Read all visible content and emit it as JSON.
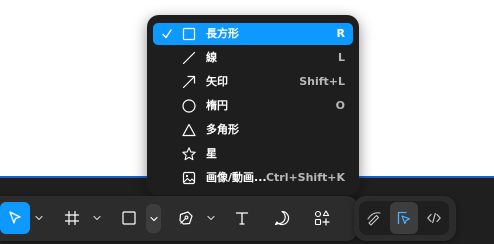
{
  "menu": {
    "items": [
      {
        "label": "長方形",
        "shortcut": "R",
        "icon": "rectangle-icon",
        "selected": true
      },
      {
        "label": "線",
        "shortcut": "L",
        "icon": "line-icon",
        "selected": false
      },
      {
        "label": "矢印",
        "shortcut": "Shift+L",
        "icon": "arrow-icon",
        "selected": false
      },
      {
        "label": "楕円",
        "shortcut": "O",
        "icon": "ellipse-icon",
        "selected": false
      },
      {
        "label": "多角形",
        "shortcut": "",
        "icon": "polygon-icon",
        "selected": false
      },
      {
        "label": "星",
        "shortcut": "",
        "icon": "star-icon",
        "selected": false
      },
      {
        "label": "画像/動画...",
        "shortcut": "Ctrl+Shift+K",
        "icon": "image-icon",
        "selected": false
      }
    ]
  },
  "toolbar": {
    "tools": [
      {
        "name": "move-tool",
        "icon": "cursor-icon",
        "active": true
      },
      {
        "name": "frame-tool",
        "icon": "frame-icon",
        "active": false
      },
      {
        "name": "shape-tool",
        "icon": "rectangle-icon",
        "active": false,
        "menu_open": true
      },
      {
        "name": "pen-tool",
        "icon": "pen-icon",
        "active": false
      },
      {
        "name": "text-tool",
        "icon": "text-icon",
        "active": false
      },
      {
        "name": "comment-tool",
        "icon": "comment-icon",
        "active": false
      },
      {
        "name": "actions-tool",
        "icon": "actions-icon",
        "active": false
      }
    ],
    "modes": [
      {
        "name": "draw-mode",
        "icon": "pencil-icon",
        "active": false
      },
      {
        "name": "design-mode",
        "icon": "design-icon",
        "active": true
      },
      {
        "name": "dev-mode",
        "icon": "code-icon",
        "active": false
      }
    ]
  },
  "colors": {
    "accent": "#0d99ff",
    "menu_bg": "#1e1e1e",
    "toolbar_bg": "#2c2c2c",
    "canvas_border": "#1f5fbf"
  }
}
